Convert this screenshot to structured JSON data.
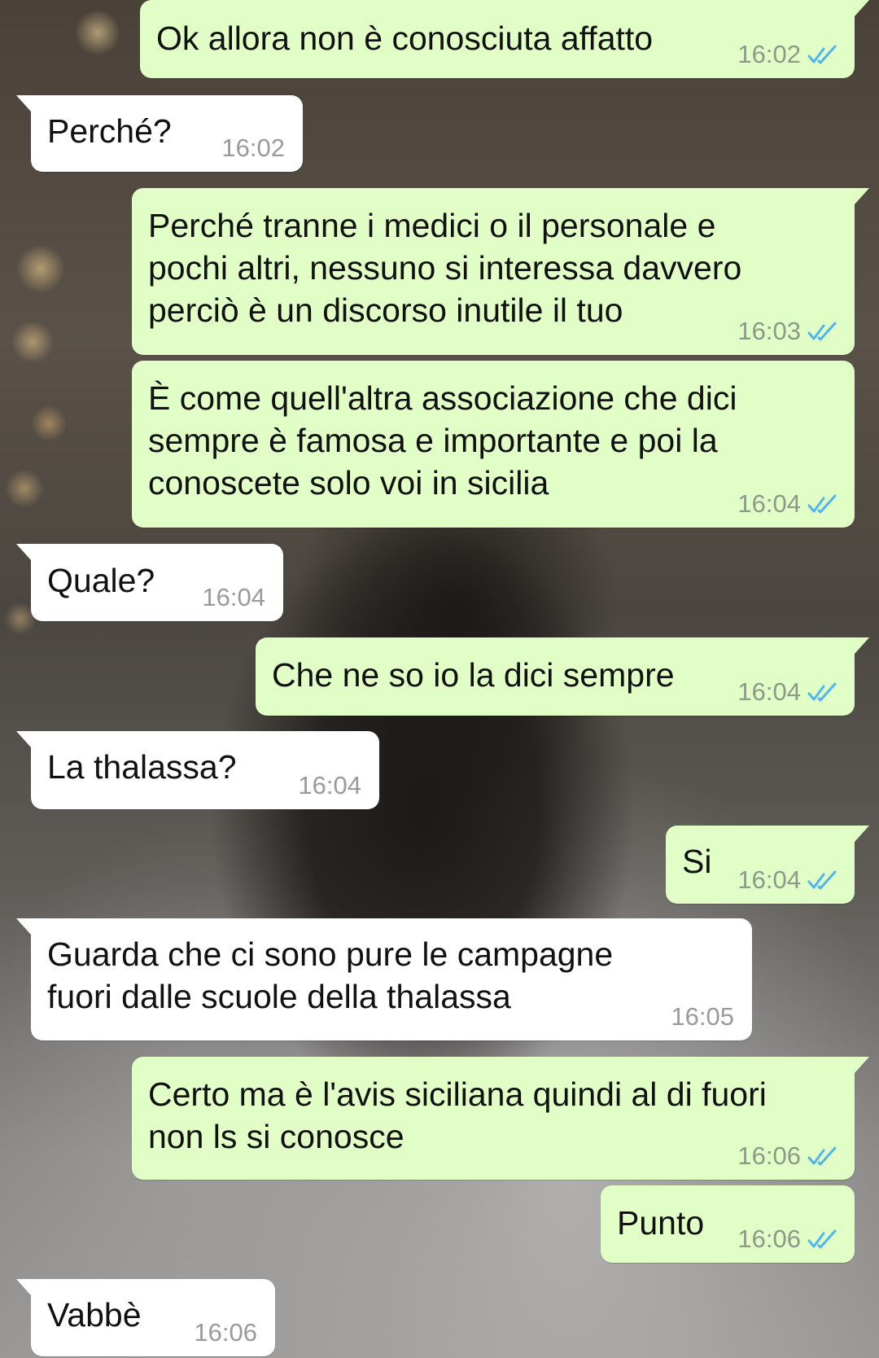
{
  "theme": {
    "outgoing_bubble": "#e1fec6",
    "incoming_bubble": "#ffffff",
    "read_receipt_color": "#4fb6ec"
  },
  "messages": [
    {
      "direction": "out",
      "text": "Ok allora non è conosciuta affatto",
      "time": "16:02",
      "status": "read"
    },
    {
      "direction": "in",
      "text": "Perché?",
      "time": "16:02"
    },
    {
      "direction": "out",
      "text": "Perché tranne i medici o il personale e\npochi altri, nessuno si interessa davvero\nperciò è un discorso inutile il tuo",
      "time": "16:03",
      "status": "read"
    },
    {
      "direction": "out",
      "text": "È come quell'altra associazione che dici\nsempre è famosa e importante e poi la\nconoscete solo voi in sicilia",
      "time": "16:04",
      "status": "read"
    },
    {
      "direction": "in",
      "text": "Quale?",
      "time": "16:04"
    },
    {
      "direction": "out",
      "text": "Che ne so io la dici sempre",
      "time": "16:04",
      "status": "read"
    },
    {
      "direction": "in",
      "text": "La thalassa?",
      "time": "16:04"
    },
    {
      "direction": "out",
      "text": "Si",
      "time": "16:04",
      "status": "read"
    },
    {
      "direction": "in",
      "text": "Guarda che ci sono pure le campagne\nfuori dalle scuole della thalassa",
      "time": "16:05"
    },
    {
      "direction": "out",
      "text": "Certo ma è l'avis siciliana quindi al di fuori\nnon ls si conosce",
      "time": "16:06",
      "status": "read"
    },
    {
      "direction": "out",
      "text": "Punto",
      "time": "16:06",
      "status": "read"
    },
    {
      "direction": "in",
      "text": "Vabbè",
      "time": "16:06"
    }
  ]
}
